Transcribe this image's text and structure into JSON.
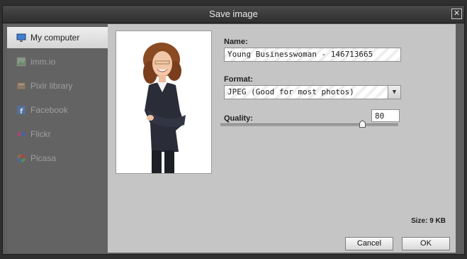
{
  "window": {
    "title": "Save image",
    "close_label": "✕"
  },
  "sidebar": {
    "items": [
      {
        "label": "My computer",
        "icon": "monitor-icon",
        "active": true
      },
      {
        "label": "imm.io",
        "icon": "image-icon",
        "active": false
      },
      {
        "label": "Pixlr library",
        "icon": "library-icon",
        "active": false
      },
      {
        "label": "Facebook",
        "icon": "facebook-icon",
        "active": false
      },
      {
        "label": "Flickr",
        "icon": "flickr-icon",
        "active": false
      },
      {
        "label": "Picasa",
        "icon": "picasa-icon",
        "active": false
      }
    ]
  },
  "form": {
    "name_label": "Name:",
    "name_value": "Young Businesswoman - 146713665",
    "format_label": "Format:",
    "format_value": "JPEG (Good for most photos)",
    "quality_label": "Quality:",
    "quality_value": "80",
    "quality_fraction": 0.8
  },
  "status": {
    "size_text": "Size: 9 KB"
  },
  "buttons": {
    "cancel": "Cancel",
    "ok": "OK"
  },
  "colors": {
    "panel": "#c5c5c5",
    "sidebar": "#636363",
    "titlebar": "#3a3a3a"
  }
}
